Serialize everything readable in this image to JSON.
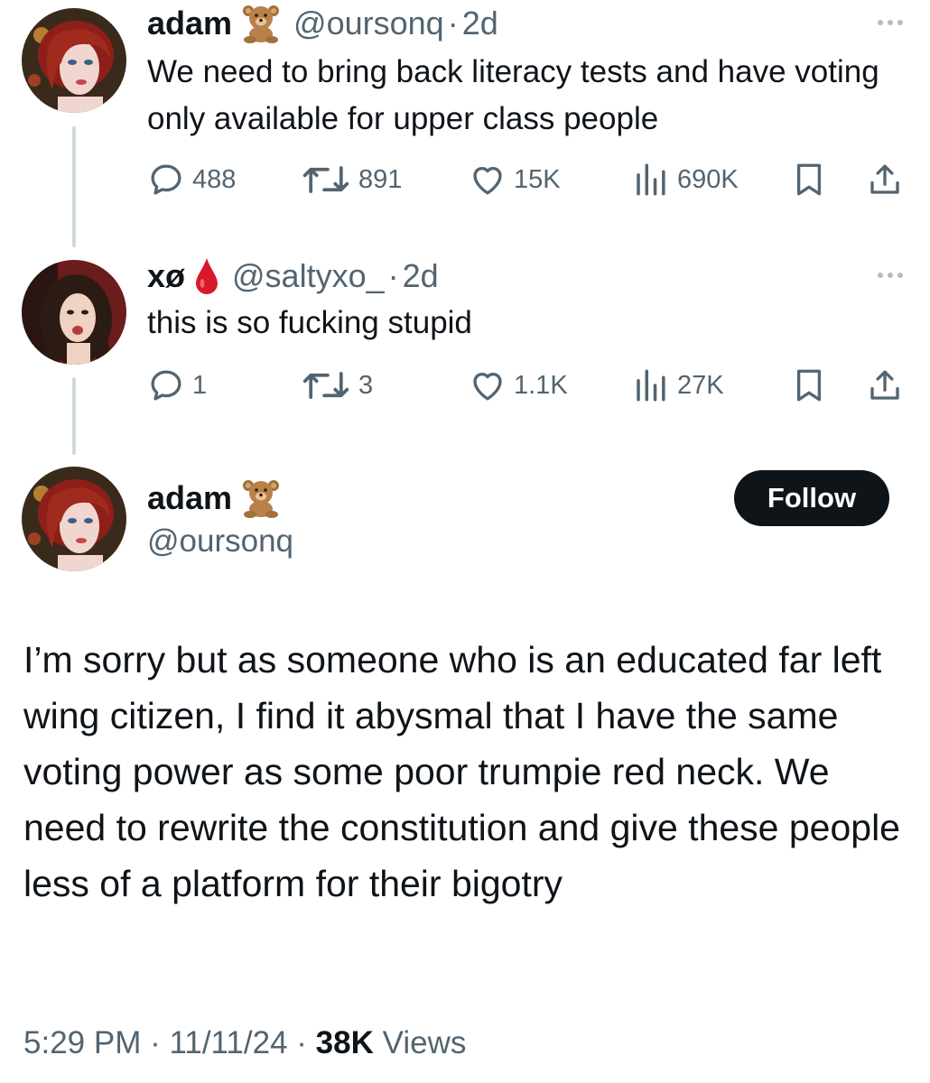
{
  "tweets": [
    {
      "name": "adam",
      "name_emoji": "teddy-bear-emoji",
      "handle": "@oursonq",
      "time": "2d",
      "text": "We need to bring back literacy tests and have voting only available for upper class people",
      "replies": "488",
      "reposts": "891",
      "likes": "15K",
      "views": "690K"
    },
    {
      "name": "xø",
      "name_emoji": "drop-of-blood-emoji",
      "handle": "@saltyxo_",
      "time": "2d",
      "text": "this is so fucking stupid",
      "replies": "1",
      "reposts": "3",
      "likes": "1.1K",
      "views": "27K"
    }
  ],
  "main_tweet": {
    "name": "adam",
    "name_emoji": "teddy-bear-emoji",
    "handle": "@oursonq",
    "follow_label": "Follow",
    "text": "I’m sorry but as someone who is an educated far left wing citizen, I find it abysmal that I have the same voting power as some poor trumpie red neck. We need to rewrite the constitution and give these people less of a platform for their bigotry",
    "time": "5:29 PM",
    "date": "11/11/24",
    "views_count": "38K",
    "views_label": "Views"
  },
  "separator": "·",
  "colors": {
    "text": "#0f1419",
    "secondary": "#536471",
    "thread_line": "#cfd9de",
    "follow_bg": "#0f1419"
  }
}
